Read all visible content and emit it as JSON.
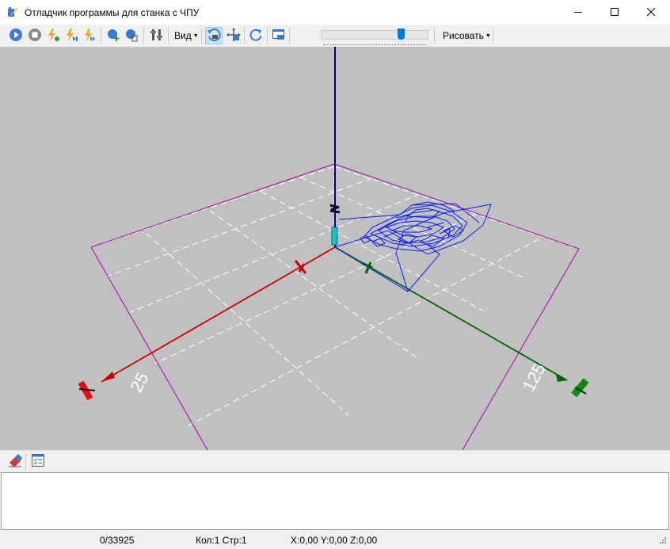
{
  "window": {
    "title": "Отладчик программы для станка с ЧПУ",
    "minimize_icon": "minimize-icon",
    "maximize_icon": "maximize-icon",
    "close_icon": "close-icon"
  },
  "toolbar": {
    "buttons": [
      {
        "name": "run-button",
        "icon": "play-icon",
        "color": "#3a7bd5"
      },
      {
        "name": "stop-button",
        "icon": "stop-icon",
        "color": "#8a8a8a"
      },
      {
        "name": "run-to-point-button",
        "icon": "lightning-point-icon",
        "color": "#f5a623"
      },
      {
        "name": "step-button",
        "icon": "lightning-step-icon",
        "color": "#f5a623"
      },
      {
        "name": "fast-forward-button",
        "icon": "lightning-forward-icon",
        "color": "#f5a623"
      },
      {
        "name": "add-breakpoint-button",
        "icon": "add-breakpoint-icon",
        "color": "#3a7bd5"
      },
      {
        "name": "delete-breakpoint-button",
        "icon": "delete-breakpoint-icon",
        "color": "#3a7bd5"
      },
      {
        "name": "settings-button",
        "icon": "tools-icon",
        "color": "#555555"
      },
      {
        "name": "rotate-view-button",
        "icon": "rotate-camera-icon",
        "color": "#3a7bd5",
        "active": true
      },
      {
        "name": "pan-view-button",
        "icon": "pan-camera-icon",
        "color": "#555555"
      },
      {
        "name": "refresh-button",
        "icon": "refresh-icon",
        "color": "#3a7bd5"
      },
      {
        "name": "screenshot-button",
        "icon": "window-camera-icon",
        "color": "#3a7bd5"
      }
    ],
    "view_menu_label": "Вид",
    "draw_menu_label": "Рисовать",
    "speed_slider_value": 0.75
  },
  "viewport": {
    "background": "#c0c0c0",
    "x_axis_color": "#cc0000",
    "y_axis_color": "#006400",
    "z_axis_color": "#00007a",
    "boundary_color": "#aa00aa",
    "toolpath_color": "#0a1ef0",
    "x_axis_label": "25",
    "y_axis_label": "125"
  },
  "bottom_toolbar": {
    "buttons": [
      {
        "name": "clear-log-button",
        "icon": "eraser-icon"
      },
      {
        "name": "log-options-button",
        "icon": "checklist-icon"
      }
    ]
  },
  "statusbar": {
    "progress": "0/33925",
    "position": "Кол:1 Стр:1",
    "coordinates": "X:0,00 Y:0,00 Z:0,00"
  }
}
